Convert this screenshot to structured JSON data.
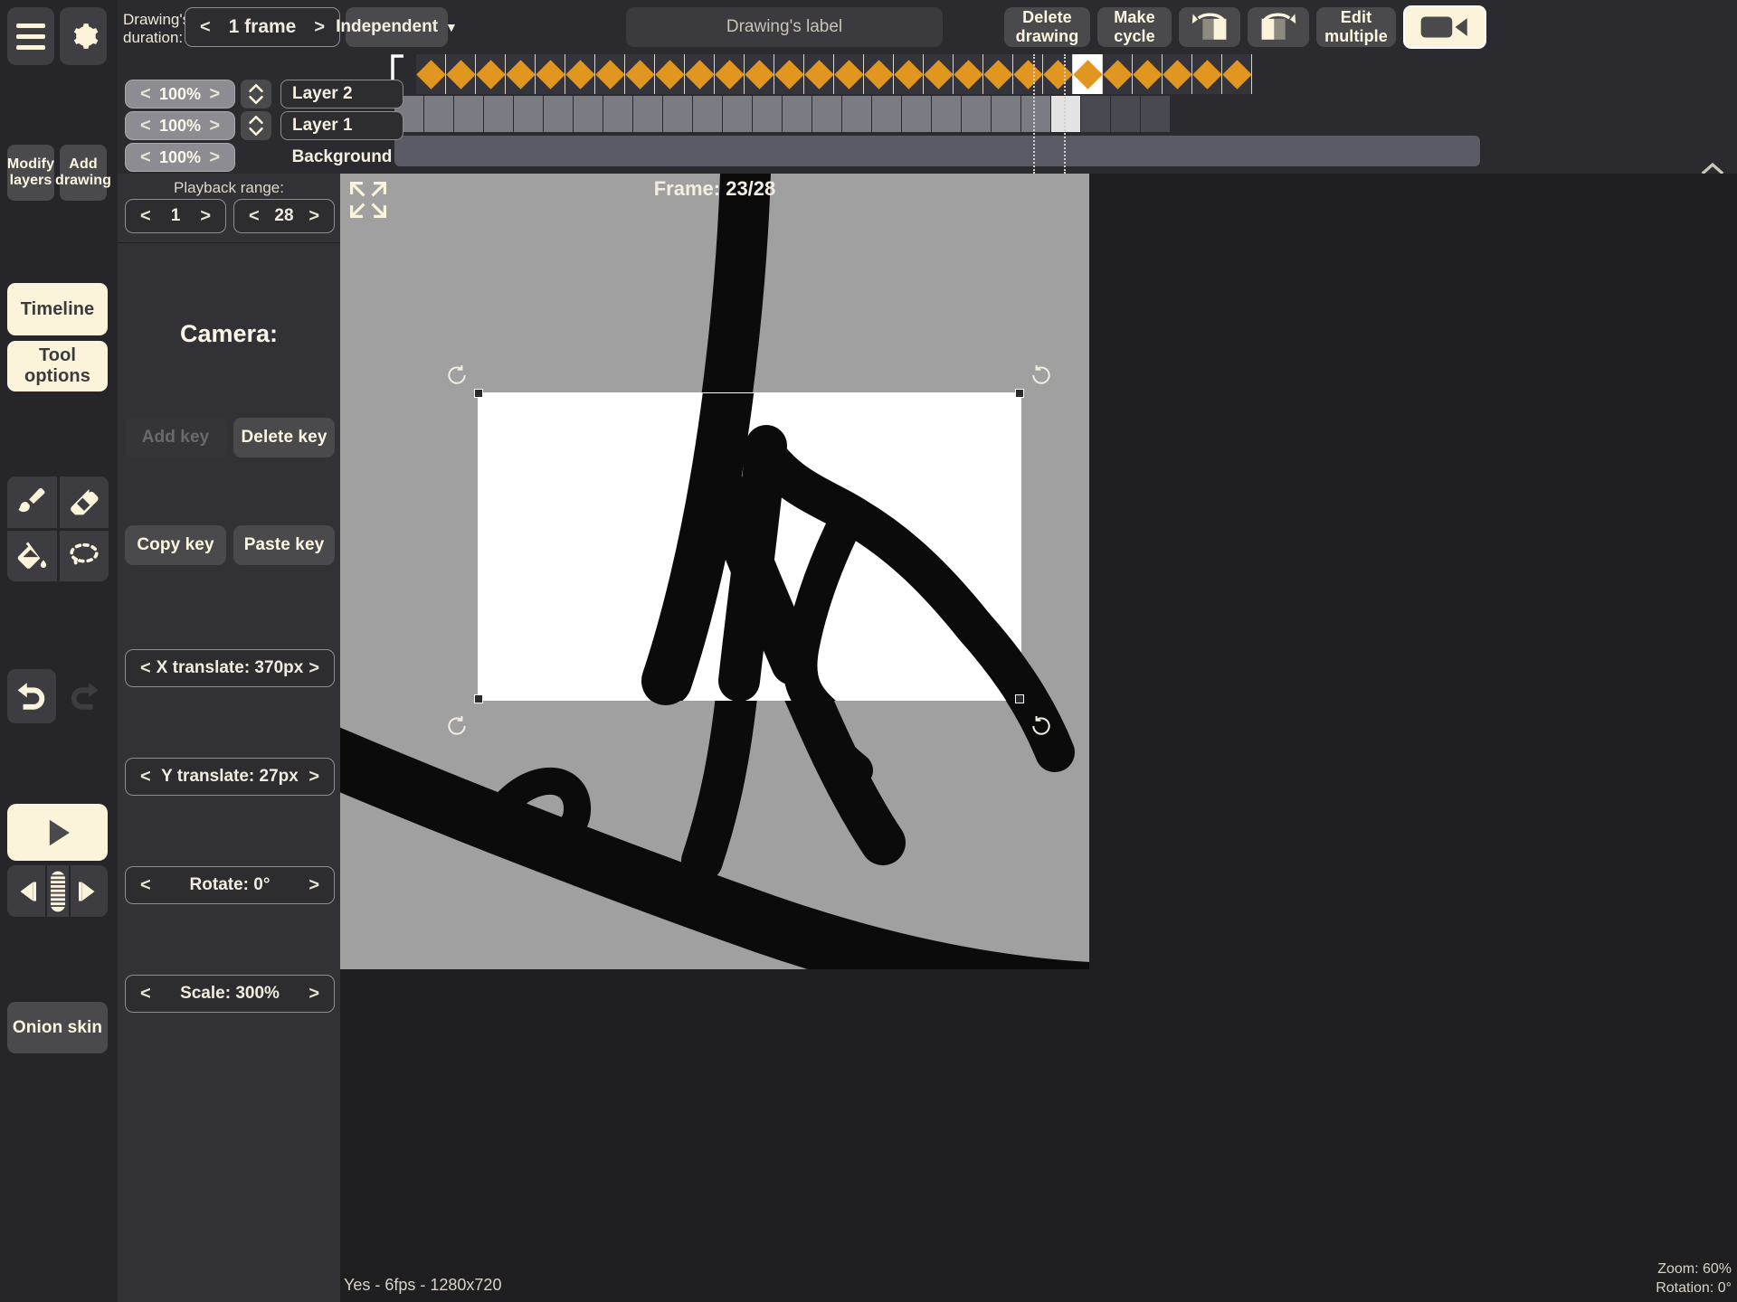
{
  "toolbar": {
    "duration_label": "Drawing's\nduration:",
    "duration_value": "1 frame",
    "independent_label": "Independent",
    "drawing_label_placeholder": "Drawing's label",
    "delete_drawing": "Delete\ndrawing",
    "make_cycle": "Make\ncycle",
    "edit_multiple": "Edit\nmultiple",
    "prev_turn_icon": "rotate-left-page-icon",
    "next_turn_icon": "rotate-right-page-icon",
    "camera_icon": "video-camera-icon",
    "menu_icon": "hamburger-menu-icon",
    "settings_icon": "gear-icon",
    "arrow_left": "<",
    "arrow_right": ">",
    "caret_down": "▼"
  },
  "rail": {
    "modify_layers": "Modify\nlayers",
    "add_drawing": "Add\ndrawing",
    "timeline": "Timeline",
    "tool_options": "Tool options",
    "onion_skin": "Onion skin",
    "tools": [
      {
        "name": "brush-icon"
      },
      {
        "name": "eraser-icon"
      },
      {
        "name": "paint-bucket-icon"
      },
      {
        "name": "lasso-select-icon"
      }
    ],
    "undo_icon": "undo-arrow-icon",
    "redo_icon": "redo-arrow-icon",
    "play_icon": "play-triangle-icon",
    "prev_frame_icon": "previous-frame-icon",
    "next_frame_icon": "next-frame-icon"
  },
  "layers": [
    {
      "opacity": "100%",
      "name": "Layer 2",
      "has_reorder": true,
      "editable": true
    },
    {
      "opacity": "100%",
      "name": "Layer 1",
      "has_reorder": true,
      "editable": true
    },
    {
      "opacity": "100%",
      "name": "Background",
      "has_reorder": false,
      "editable": false
    }
  ],
  "playback": {
    "range_label": "Playback range:",
    "start": "1",
    "end": "28"
  },
  "camera": {
    "title": "Camera:",
    "add_key": "Add key",
    "add_key_enabled": false,
    "delete_key": "Delete key",
    "copy_key": "Copy key",
    "paste_key": "Paste key",
    "transforms": [
      {
        "label": "X translate: 370px"
      },
      {
        "label": "Y translate: 27px"
      },
      {
        "label": "Rotate:  0°"
      },
      {
        "label": "Scale: 300%"
      }
    ]
  },
  "timeline": {
    "total_cells": 28,
    "selected_index": 22,
    "dotted_markers": [
      12,
      22,
      25
    ],
    "row2_cells": 26,
    "row2_selected": 22,
    "diamond_color": "#e0961f"
  },
  "canvas": {
    "frame_label": "Frame: 23/28",
    "status_left": "Yes - 6fps - 1280x720",
    "zoom": "Zoom: 60%",
    "rotation": "Rotation: 0°",
    "fit_icon": "fit-to-screen-icon"
  },
  "colors": {
    "accent_cream": "#fbf3da",
    "diamond": "#e0961f",
    "panel": "#2b2b2f",
    "panel_dark": "#232326",
    "canvas_bg": "#a0a0a0"
  }
}
